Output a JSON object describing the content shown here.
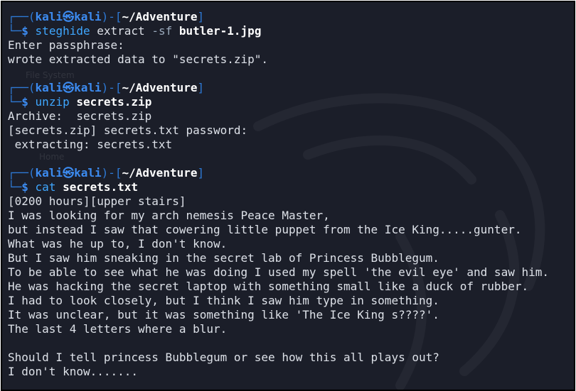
{
  "desktop_ghost": {
    "file_system_label": "File System",
    "home_label": "Home"
  },
  "prompt": {
    "user": "kali",
    "host": "kali",
    "symbol": "㉿",
    "cwd": "~/Adventure",
    "dollar": "$"
  },
  "blocks": [
    {
      "command": "steghide",
      "args_plain": " extract ",
      "option": "-sf",
      "arg_bold": " butler-1.jpg",
      "output": [
        "Enter passphrase:",
        "wrote extracted data to \"secrets.zip\"."
      ]
    },
    {
      "command": "unzip",
      "args_plain": " ",
      "option": "",
      "arg_bold": "secrets.zip",
      "output": [
        "Archive:  secrets.zip",
        "[secrets.zip] secrets.txt password:",
        " extracting: secrets.txt"
      ]
    },
    {
      "command": "cat",
      "args_plain": " ",
      "option": "",
      "arg_bold": "secrets.txt",
      "output": [
        "[0200 hours][upper stairs]",
        "I was looking for my arch nemesis Peace Master,",
        "but instead I saw that cowering little puppet from the Ice King.....gunter.",
        "What was he up to, I don't know.",
        "But I saw him sneaking in the secret lab of Princess Bubblegum.",
        "To be able to see what he was doing I used my spell 'the evil eye' and saw him.",
        "He was hacking the secret laptop with something small like a duck of rubber.",
        "I had to look closely, but I think I saw him type in something.",
        "It was unclear, but it was something like 'The Ice King s????'.",
        "The last 4 letters where a blur.",
        "",
        "Should I tell princess Bubblegum or see how this all plays out?",
        "I don't know......."
      ]
    }
  ]
}
